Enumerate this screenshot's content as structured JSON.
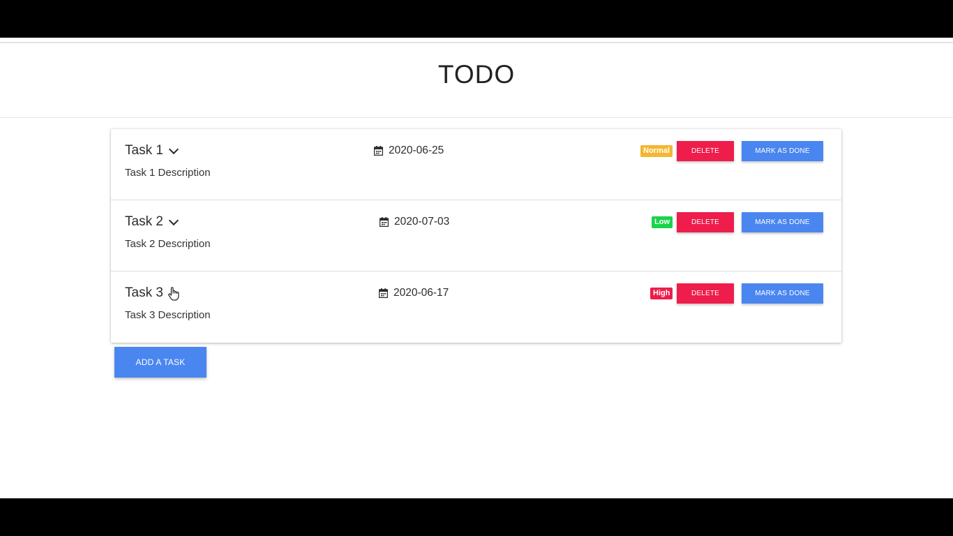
{
  "header": {
    "title": "TODO"
  },
  "tasks": [
    {
      "title": "Task 1",
      "description": "Task 1 Description",
      "date": "2020-06-25",
      "priority": "Normal",
      "priority_color": "#f4b731",
      "delete_label": "DELETE",
      "done_label": "MARK AS DONE",
      "title_icon": "chevron-down-icon"
    },
    {
      "title": "Task 2",
      "description": "Task 2 Description",
      "date": "2020-07-03",
      "priority": "Low",
      "priority_color": "#19d34a",
      "delete_label": "DELETE",
      "done_label": "MARK AS DONE",
      "title_icon": "chevron-down-icon"
    },
    {
      "title": "Task 3",
      "description": "Task 3 Description",
      "date": "2020-06-17",
      "priority": "High",
      "priority_color": "#ee1d4b",
      "delete_label": "DELETE",
      "done_label": "MARK AS DONE",
      "title_icon": "hand-pointer-cursor-icon"
    }
  ],
  "add_button_label": "ADD A TASK",
  "colors": {
    "primary": "#4a86f0",
    "danger": "#ee1d4b",
    "warning": "#f4b731",
    "success": "#19d34a"
  }
}
